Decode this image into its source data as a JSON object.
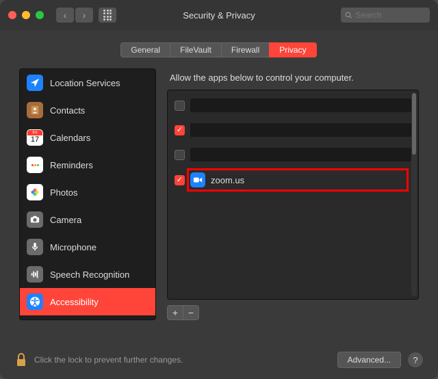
{
  "window": {
    "title": "Security & Privacy",
    "search_placeholder": "Search"
  },
  "tabs": [
    {
      "label": "General",
      "active": false
    },
    {
      "label": "FileVault",
      "active": false
    },
    {
      "label": "Firewall",
      "active": false
    },
    {
      "label": "Privacy",
      "active": true
    }
  ],
  "sidebar": {
    "items": [
      {
        "name": "location-services",
        "label": "Location Services",
        "icon_bg": "#1e82ff"
      },
      {
        "name": "contacts",
        "label": "Contacts",
        "icon_bg": "#a96c3a"
      },
      {
        "name": "calendars",
        "label": "Calendars",
        "icon_bg": "#ffffff"
      },
      {
        "name": "reminders",
        "label": "Reminders",
        "icon_bg": "#ffffff"
      },
      {
        "name": "photos",
        "label": "Photos",
        "icon_bg": "#ffffff"
      },
      {
        "name": "camera",
        "label": "Camera",
        "icon_bg": "#6b6b6b"
      },
      {
        "name": "microphone",
        "label": "Microphone",
        "icon_bg": "#6b6b6b"
      },
      {
        "name": "speech-recognition",
        "label": "Speech Recognition",
        "icon_bg": "#6b6b6b"
      },
      {
        "name": "accessibility",
        "label": "Accessibility",
        "icon_bg": "#1e82ff",
        "selected": true
      }
    ]
  },
  "main": {
    "header": "Allow the apps below to control your computer.",
    "apps": [
      {
        "checked": false,
        "redacted": true
      },
      {
        "checked": true,
        "redacted": true
      },
      {
        "checked": false,
        "redacted": true
      },
      {
        "checked": true,
        "redacted": false,
        "name": "zoom.us",
        "icon_bg": "#1e82ff",
        "highlighted": true
      }
    ],
    "add_label": "+",
    "remove_label": "−"
  },
  "footer": {
    "lock_text": "Click the lock to prevent further changes.",
    "advanced_label": "Advanced...",
    "help_label": "?"
  }
}
